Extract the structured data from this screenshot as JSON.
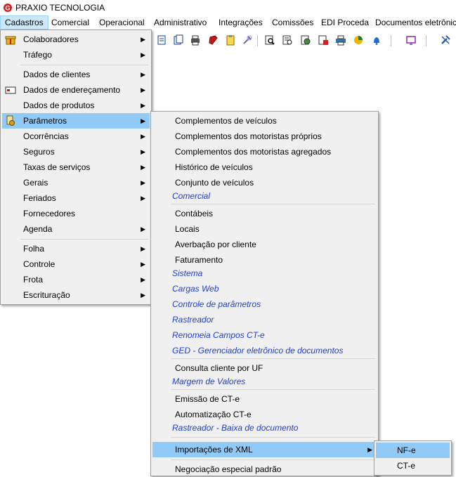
{
  "app": {
    "title": "PRAXIO TECNOLOGIA",
    "logo_icon": "praxio-logo-icon",
    "accent": "#d62020"
  },
  "menubar": {
    "items": [
      "Cadastros",
      "Comercial",
      "Operacional",
      "Administrativo",
      "Integrações",
      "Comissões",
      "EDI Proceda",
      "Documentos eletrônic"
    ],
    "active": "Cadastros"
  },
  "toolbar": {
    "icons": [
      "document-icon",
      "documents-icon",
      "printer-icon",
      "book-icon",
      "clipboard-icon",
      "tools-icon",
      "search-document-icon",
      "report-icon",
      "gear-document-icon",
      "list-icon",
      "printer2-icon",
      "pie-chart-icon",
      "bell-icon",
      "monitor-icon",
      "wrench-icon"
    ]
  },
  "cadastros_menu": {
    "items": [
      {
        "label": "Colaboradores",
        "submenu": true,
        "icon": "gift-icon"
      },
      {
        "label": "Tráfego",
        "submenu": true
      },
      {
        "label": "Dados de clientes",
        "submenu": true
      },
      {
        "label": "Dados de endereçamento",
        "submenu": true,
        "icon": "envelope-icon"
      },
      {
        "label": "Dados de produtos",
        "submenu": true
      },
      {
        "label": "Parâmetros",
        "submenu": true,
        "icon": "parameters-icon",
        "highlighted": true
      },
      {
        "label": "Ocorrências",
        "submenu": true
      },
      {
        "label": "Seguros",
        "submenu": true
      },
      {
        "label": "Taxas de serviços",
        "submenu": true
      },
      {
        "label": "Gerais",
        "submenu": true
      },
      {
        "label": "Feriados",
        "submenu": true
      },
      {
        "label": "Fornecedores",
        "submenu": false
      },
      {
        "label": "Agenda",
        "submenu": true
      },
      {
        "label": "Folha",
        "submenu": true
      },
      {
        "label": "Controle",
        "submenu": true
      },
      {
        "label": "Frota",
        "submenu": true
      },
      {
        "label": "Escrituração",
        "submenu": true
      }
    ]
  },
  "parametros_menu": {
    "items": [
      {
        "label": "Complementos de veículos"
      },
      {
        "label": "Complementos dos motoristas próprios"
      },
      {
        "label": "Complementos dos motoristas agregados"
      },
      {
        "label": "Histórico de veículos"
      },
      {
        "label": "Conjunto de veículos"
      },
      {
        "label": "Comercial",
        "section": true
      },
      {
        "label": "Contábeis"
      },
      {
        "label": "Locais"
      },
      {
        "label": "Averbação por cliente"
      },
      {
        "label": "Faturamento"
      },
      {
        "label": "Sistema",
        "section": true
      },
      {
        "label": "Cargas Web",
        "section": true
      },
      {
        "label": "Controle de parâmetros",
        "section": true
      },
      {
        "label": "Rastreador",
        "section": true
      },
      {
        "label": "Renomeia Campos CT-e",
        "section": true
      },
      {
        "label": "GED - Gerenciador eletrônico de documentos",
        "section": true
      },
      {
        "label": "Consulta cliente por UF"
      },
      {
        "label": "Margem de Valores",
        "section": true
      },
      {
        "label": "Emissão de CT-e"
      },
      {
        "label": "Automatização CT-e"
      },
      {
        "label": "Rastreador - Baixa de documento",
        "section": true
      },
      {
        "label": "Importações de XML",
        "submenu": true,
        "highlighted": true
      },
      {
        "label": "Negociação especial padrão"
      }
    ]
  },
  "xml_menu": {
    "items": [
      {
        "label": "NF-e",
        "highlighted": true
      },
      {
        "label": "CT-e"
      }
    ]
  }
}
